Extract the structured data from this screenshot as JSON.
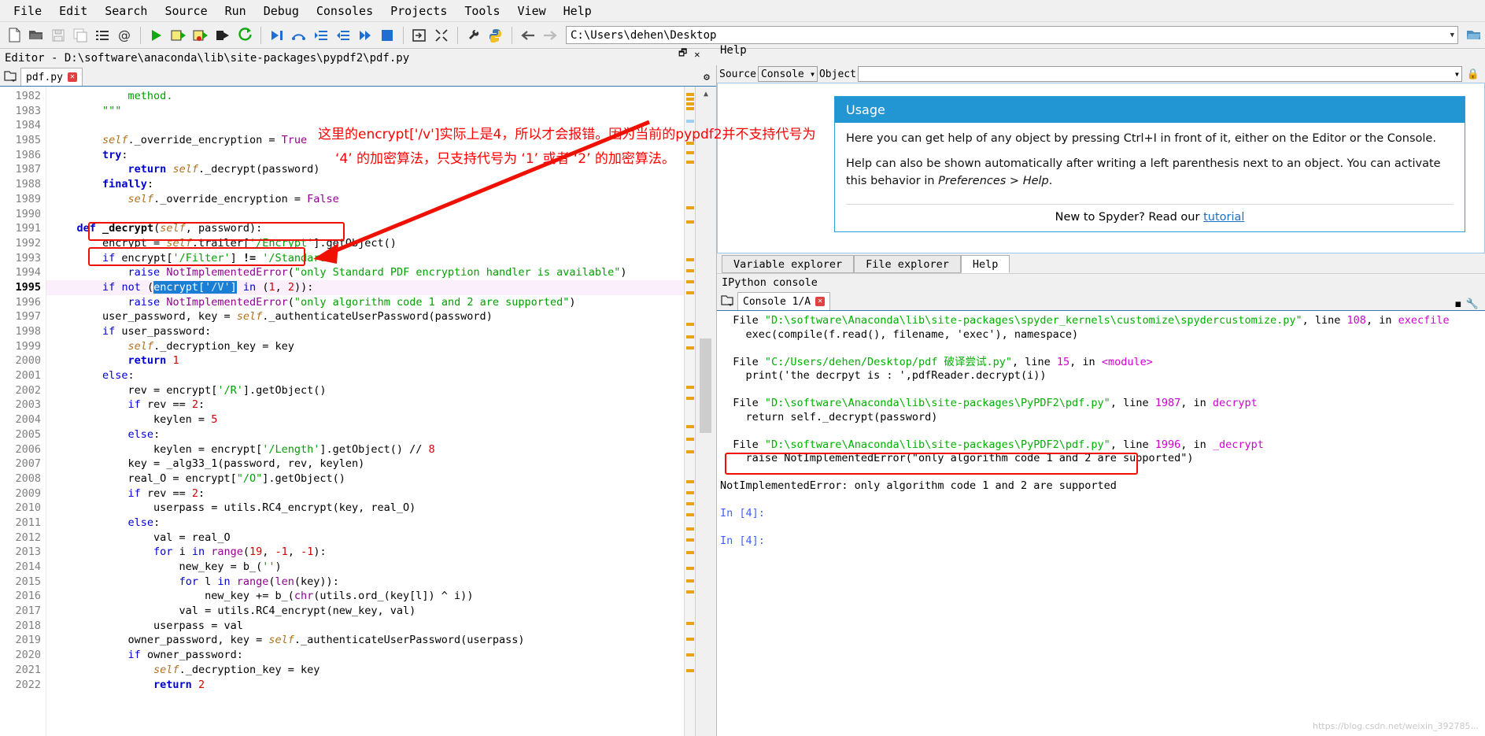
{
  "menubar": {
    "items": [
      "File",
      "Edit",
      "Search",
      "Source",
      "Run",
      "Debug",
      "Consoles",
      "Projects",
      "Tools",
      "View",
      "Help"
    ]
  },
  "toolbar": {
    "icons": [
      "new-file-icon",
      "open-file-icon",
      "save-file-icon",
      "save-all-icon",
      "file-switcher-icon",
      "at-icon",
      "run-file-icon",
      "run-cell-icon",
      "run-cell-advance-icon",
      "run-selection-icon",
      "rerun-icon",
      "debug-icon",
      "step-over-icon",
      "step-into-icon",
      "step-return-icon",
      "continue-icon",
      "stop-debug-icon",
      "maximize-pane-icon",
      "fullscreen-icon",
      "preferences-icon",
      "pythonpath-icon"
    ],
    "path_value": "C:\\Users\\dehen\\Desktop",
    "back_icon": "back-arrow-icon",
    "forward_icon": "forward-arrow-icon",
    "browse_icon": "browse-folder-icon"
  },
  "editor": {
    "panel_title": "Editor - D:\\software\\anaconda\\lib\\site-packages\\pypdf2\\pdf.py",
    "undock_icon": "undock-icon",
    "close_icon": "close-icon",
    "options_icon": "gear-icon",
    "browse_tabs_icon": "browse-tabs-icon",
    "tab_name": "pdf.py",
    "tab_close_icon": "close-tab-icon",
    "first_line_number": 1982,
    "current_line": 1995,
    "lines": [
      {
        "n": 1982,
        "html": "            <span class=\"com\">method.</span>"
      },
      {
        "n": 1983,
        "html": "        <span class=\"com\">\"\"\"</span>"
      },
      {
        "n": 1984,
        "html": ""
      },
      {
        "n": 1985,
        "html": "        <span class=\"selfk\">self</span>._override_encryption = <span class=\"bi\">True</span>"
      },
      {
        "n": 1986,
        "html": "        <span class=\"kw\">try</span>:"
      },
      {
        "n": 1987,
        "html": "            <span class=\"kw\">return</span> <span class=\"selfk\">self</span>._decrypt(password)"
      },
      {
        "n": 1988,
        "html": "        <span class=\"kw\">finally</span>:"
      },
      {
        "n": 1989,
        "html": "            <span class=\"selfk\">self</span>._override_encryption = <span class=\"bi\">False</span>"
      },
      {
        "n": 1990,
        "html": ""
      },
      {
        "n": 1991,
        "html": "    <span class=\"kw\">def</span> <span class=\"fn\">_decrypt</span>(<span class=\"selfk\">self</span>, password):"
      },
      {
        "n": 1992,
        "html": "        encrypt = <span class=\"selfk\">self</span>.trailer[<span class=\"str\">'/Encrypt'</span>].getObject()"
      },
      {
        "n": 1993,
        "html": "        <span class=\"kw2\">if</span> encrypt[<span class=\"str\">'/Filter'</span>] <span class=\"fn\">!=</span> <span class=\"str\">'/Standard'</span>:"
      },
      {
        "n": 1994,
        "html": "            <span class=\"kw2\">raise</span> <span class=\"bi\">NotImplementedError</span>(<span class=\"str\">\"only Standard PDF encryption handler is available\"</span>)"
      },
      {
        "n": 1995,
        "html": "        <span class=\"kw2\">if</span> <span class=\"kw2\">not</span> (<span class=\"sel\">encrypt[<span class=\"str\" style=\"color:#cfe8ff\">'/V'</span>]</span> <span class=\"kw2\">in</span> (<span class=\"num\">1</span>, <span class=\"num\">2</span>)):",
        "highlight": true
      },
      {
        "n": 1996,
        "html": "            <span class=\"kw2\">raise</span> <span class=\"bi\">NotImplementedError</span>(<span class=\"str\">\"only algorithm code 1 and 2 are supported\"</span>)"
      },
      {
        "n": 1997,
        "html": "        user_password, key = <span class=\"selfk\">self</span>._authenticateUserPassword(password)"
      },
      {
        "n": 1998,
        "html": "        <span class=\"kw2\">if</span> user_password:"
      },
      {
        "n": 1999,
        "html": "            <span class=\"selfk\">self</span>._decryption_key = key"
      },
      {
        "n": 2000,
        "html": "            <span class=\"kw\">return</span> <span class=\"num\">1</span>"
      },
      {
        "n": 2001,
        "html": "        <span class=\"kw2\">else</span>:"
      },
      {
        "n": 2002,
        "html": "            rev = encrypt[<span class=\"str\">'/R'</span>].getObject()"
      },
      {
        "n": 2003,
        "html": "            <span class=\"kw2\">if</span> rev == <span class=\"num\">2</span>:"
      },
      {
        "n": 2004,
        "html": "                keylen = <span class=\"num\">5</span>"
      },
      {
        "n": 2005,
        "html": "            <span class=\"kw2\">else</span>:"
      },
      {
        "n": 2006,
        "html": "                keylen = encrypt[<span class=\"str\">'/Length'</span>].getObject() // <span class=\"num\">8</span>"
      },
      {
        "n": 2007,
        "html": "            key = _alg33_1(password, rev, keylen)"
      },
      {
        "n": 2008,
        "html": "            real_O = encrypt[<span class=\"str\">\"/O\"</span>].getObject()"
      },
      {
        "n": 2009,
        "html": "            <span class=\"kw2\">if</span> rev == <span class=\"num\">2</span>:"
      },
      {
        "n": 2010,
        "html": "                userpass = utils.RC4_encrypt(key, real_O)"
      },
      {
        "n": 2011,
        "html": "            <span class=\"kw2\">else</span>:"
      },
      {
        "n": 2012,
        "html": "                val = real_O"
      },
      {
        "n": 2013,
        "html": "                <span class=\"kw2\">for</span> i <span class=\"kw2\">in</span> <span class=\"bi\">range</span>(<span class=\"num\">19</span>, <span class=\"num\">-1</span>, <span class=\"num\">-1</span>):"
      },
      {
        "n": 2014,
        "html": "                    new_key = b_(<span class=\"str\">''</span>)"
      },
      {
        "n": 2015,
        "html": "                    <span class=\"kw2\">for</span> l <span class=\"kw2\">in</span> <span class=\"bi\">range</span>(<span class=\"bi\">len</span>(key)):"
      },
      {
        "n": 2016,
        "html": "                        new_key += b_(<span class=\"bi\">chr</span>(utils.ord_(key[l]) ^ i))"
      },
      {
        "n": 2017,
        "html": "                    val = utils.RC4_encrypt(new_key, val)"
      },
      {
        "n": 2018,
        "html": "                userpass = val"
      },
      {
        "n": 2019,
        "html": "            owner_password, key = <span class=\"selfk\">self</span>._authenticateUserPassword(userpass)"
      },
      {
        "n": 2020,
        "html": "            <span class=\"kw2\">if</span> owner_password:"
      },
      {
        "n": 2021,
        "html": "                <span class=\"selfk\">self</span>._decryption_key = key"
      },
      {
        "n": 2022,
        "html": "                <span class=\"kw\">return</span> <span class=\"num\">2</span>"
      }
    ],
    "annotation": {
      "line1": "这里的encrypt['/v']实际上是4，所以才会报错。因为当前的pypdf2并不支持代号为",
      "line2": "‘4’ 的加密算法，只支持代号为 ‘1’ 或者 ‘2’ 的加密算法。",
      "color": "#ff0000"
    }
  },
  "help": {
    "panel_title": "Help",
    "source_label": "Source",
    "source_value": "Console",
    "object_label": "Object",
    "object_value": "",
    "lock_icon": "lock-icon",
    "card": {
      "title": "Usage",
      "paragraph1": "Here you can get help of any object by pressing Ctrl+I in front of it, either on the Editor or the Console.",
      "paragraph2_a": "Help can also be shown automatically after writing a left parenthesis next to an object. You can activate this behavior in ",
      "paragraph2_b": "Preferences > Help",
      "paragraph2_c": ".",
      "footer_text": "New to Spyder? Read our ",
      "footer_link": "tutorial"
    },
    "tabs": [
      {
        "label": "Variable explorer",
        "active": false
      },
      {
        "label": "File explorer",
        "active": false
      },
      {
        "label": "Help",
        "active": true
      }
    ]
  },
  "console": {
    "panel_title": "IPython console",
    "tab_name": "Console 1/A",
    "tab_close_icon": "close-tab-icon",
    "browse_tabs_icon": "browse-tabs-icon",
    "options_icon": "gear-icon",
    "undock_icon": "undock-icon",
    "lines": [
      {
        "segments": [
          {
            "t": "  File ",
            "c": ""
          },
          {
            "t": "\"D:\\software\\Anaconda\\lib\\site-packages\\spyder_kernels\\customize\\spydercustomize.py\"",
            "c": "cgreen"
          },
          {
            "t": ", line ",
            "c": ""
          },
          {
            "t": "108",
            "c": "cmag"
          },
          {
            "t": ", in ",
            "c": ""
          },
          {
            "t": "execfile",
            "c": "cmag"
          }
        ]
      },
      {
        "segments": [
          {
            "t": "    exec(compile(f.read(), filename, 'exec'), namespace)",
            "c": ""
          }
        ]
      },
      {
        "segments": [
          {
            "t": "",
            "c": ""
          }
        ]
      },
      {
        "segments": [
          {
            "t": "  File ",
            "c": ""
          },
          {
            "t": "\"C:/Users/dehen/Desktop/pdf 破译尝试.py\"",
            "c": "cgreen"
          },
          {
            "t": ", line ",
            "c": ""
          },
          {
            "t": "15",
            "c": "cmag"
          },
          {
            "t": ", in ",
            "c": ""
          },
          {
            "t": "<module>",
            "c": "cmag"
          }
        ]
      },
      {
        "segments": [
          {
            "t": "    print('the decrpyt is : ',pdfReader.decrypt(i))",
            "c": ""
          }
        ]
      },
      {
        "segments": [
          {
            "t": "",
            "c": ""
          }
        ]
      },
      {
        "segments": [
          {
            "t": "  File ",
            "c": ""
          },
          {
            "t": "\"D:\\software\\Anaconda\\lib\\site-packages\\PyPDF2\\pdf.py\"",
            "c": "cgreen"
          },
          {
            "t": ", line ",
            "c": ""
          },
          {
            "t": "1987",
            "c": "cmag"
          },
          {
            "t": ", in ",
            "c": ""
          },
          {
            "t": "decrypt",
            "c": "cmag"
          }
        ]
      },
      {
        "segments": [
          {
            "t": "    return self._decrypt(password)",
            "c": ""
          }
        ]
      },
      {
        "segments": [
          {
            "t": "",
            "c": ""
          }
        ]
      },
      {
        "segments": [
          {
            "t": "  File ",
            "c": ""
          },
          {
            "t": "\"D:\\software\\Anaconda\\lib\\site-packages\\PyPDF2\\pdf.py\"",
            "c": "cgreen"
          },
          {
            "t": ", line ",
            "c": ""
          },
          {
            "t": "1996",
            "c": "cmag"
          },
          {
            "t": ", in ",
            "c": ""
          },
          {
            "t": "_decrypt",
            "c": "cmag"
          }
        ],
        "boxed": true
      },
      {
        "segments": [
          {
            "t": "    raise NotImplementedError(\"only algorithm code 1 and 2 are supported\")",
            "c": ""
          }
        ]
      },
      {
        "segments": [
          {
            "t": "",
            "c": ""
          }
        ]
      },
      {
        "segments": [
          {
            "t": "NotImplementedError: only algorithm code 1 and 2 are supported",
            "c": ""
          }
        ]
      },
      {
        "segments": [
          {
            "t": "",
            "c": ""
          }
        ]
      },
      {
        "segments": [
          {
            "t": "In [",
            "c": "cblue"
          },
          {
            "t": "4",
            "c": "cblue"
          },
          {
            "t": "]:",
            "c": "cblue"
          }
        ]
      },
      {
        "segments": [
          {
            "t": "",
            "c": ""
          }
        ]
      },
      {
        "segments": [
          {
            "t": "In [",
            "c": "cblue"
          },
          {
            "t": "4",
            "c": "cblue"
          },
          {
            "t": "]:",
            "c": "cblue"
          }
        ]
      }
    ],
    "watermark": "https://blog.csdn.net/weixin_392785..."
  }
}
